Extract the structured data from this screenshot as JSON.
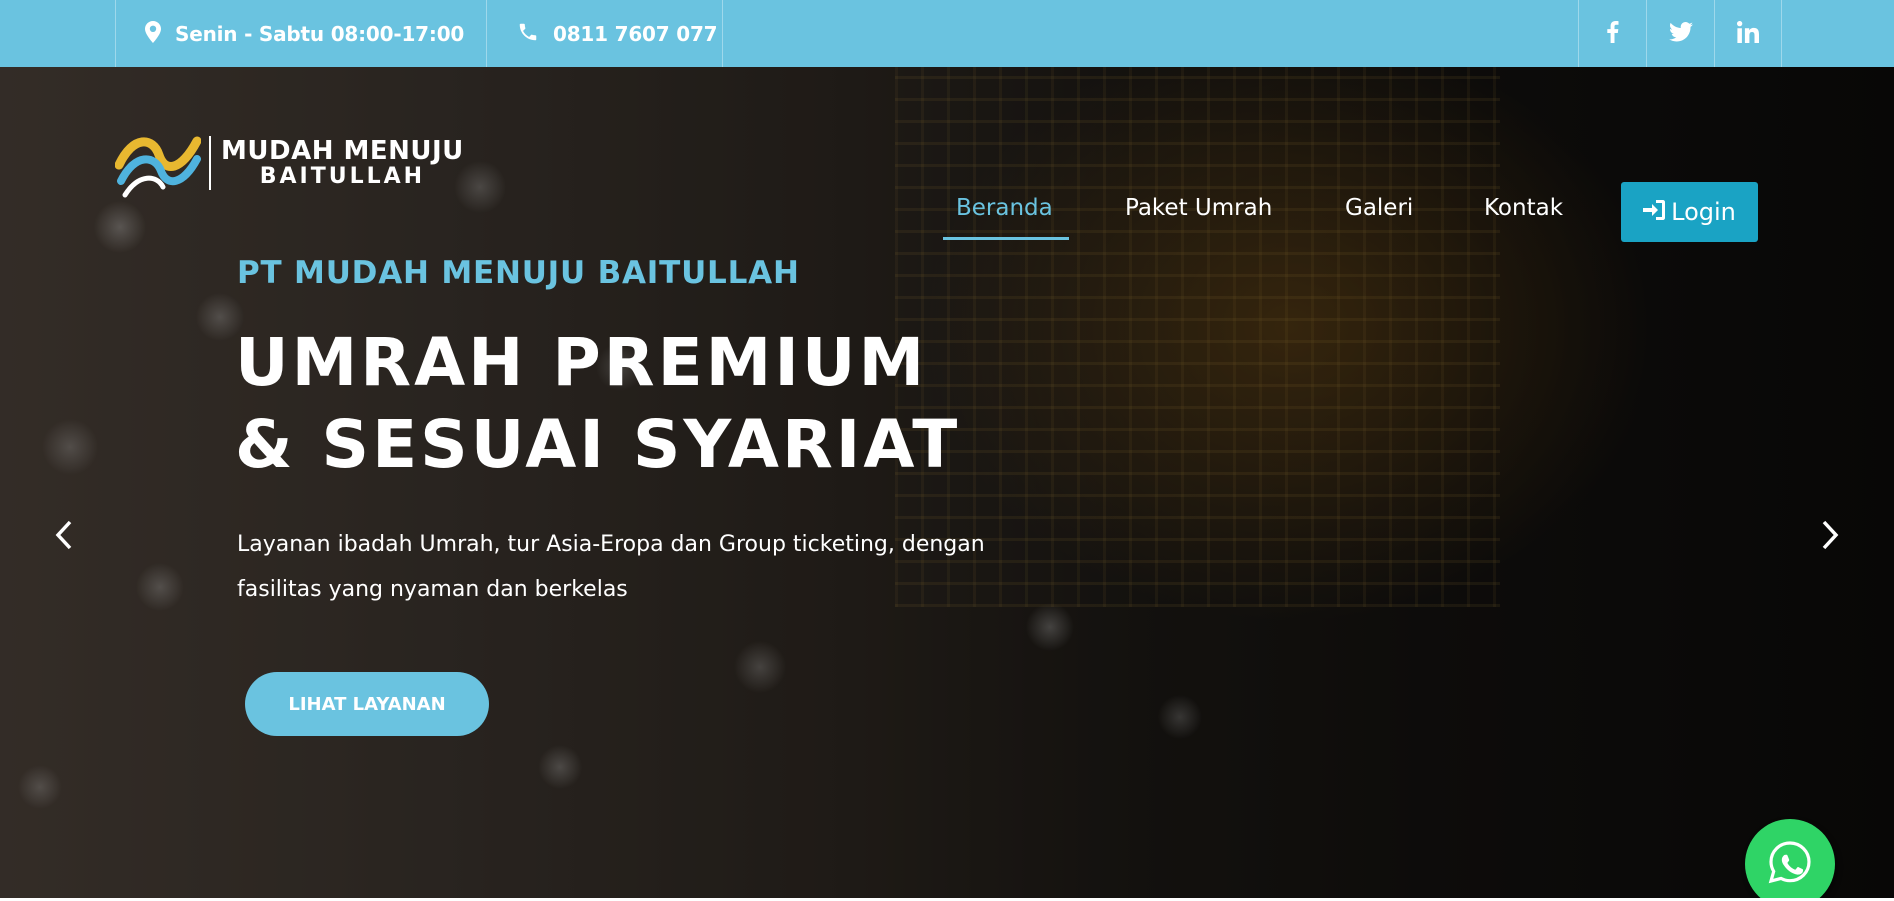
{
  "topbar": {
    "hours": "Senin - Sabtu 08:00-17:00",
    "phone": "0811 7607 077",
    "social": [
      "facebook-icon",
      "twitter-icon",
      "linkedin-icon"
    ]
  },
  "brand": {
    "line1": "MUDAH MENUJU",
    "line2": "BAITULLAH"
  },
  "nav": {
    "items": [
      {
        "label": "Beranda",
        "active": true
      },
      {
        "label": "Paket Umrah",
        "active": false
      },
      {
        "label": "Galeri",
        "active": false
      },
      {
        "label": "Kontak",
        "active": false
      }
    ],
    "login_label": "Login"
  },
  "hero": {
    "kicker": "PT MUDAH MENUJU BAITULLAH",
    "headline_line1": "UMRAH PREMIUM",
    "headline_line2": "& SESUAI SYARIAT",
    "lead": "Layanan ibadah Umrah, tur Asia-Eropa dan Group ticketing, dengan fasilitas yang nyaman dan berkelas",
    "cta_label": "LIHAT LAYANAN"
  },
  "colors": {
    "accent": "#6ac3e0",
    "login_button": "#1aa3c4",
    "whatsapp": "#2fd466"
  }
}
